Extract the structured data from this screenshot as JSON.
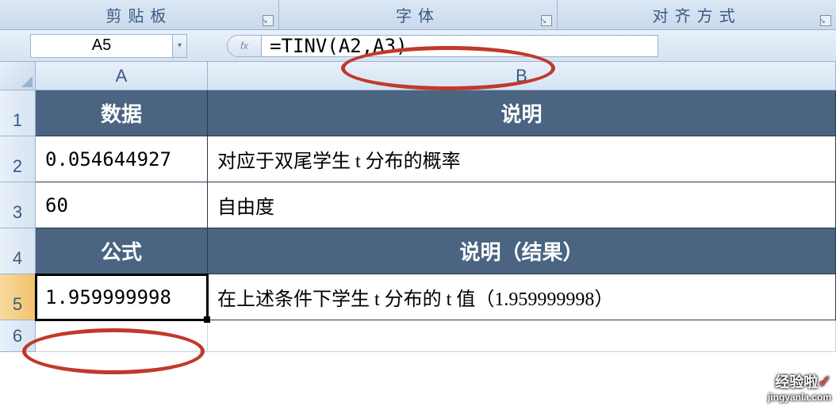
{
  "ribbon": {
    "groups": [
      "剪贴板",
      "字体",
      "对齐方式"
    ]
  },
  "formula_bar": {
    "cell_ref": "A5",
    "fx_label": "fx",
    "formula": "=TINV(A2,A3)"
  },
  "columns": [
    "A",
    "B"
  ],
  "rows": [
    "1",
    "2",
    "3",
    "4",
    "5",
    "6"
  ],
  "cells": {
    "A1": "数据",
    "B1": "说明",
    "A2": "0.054644927",
    "B2": "对应于双尾学生 t 分布的概率",
    "A3": "60",
    "B3": "自由度",
    "A4": "公式",
    "B4": "说明（结果）",
    "A5": "1.959999998",
    "B5": "在上述条件下学生 t 分布的 t 值（1.959999998）"
  },
  "watermark": {
    "brand": "经验啦",
    "check": "✓",
    "url": "jingyanla.com"
  }
}
